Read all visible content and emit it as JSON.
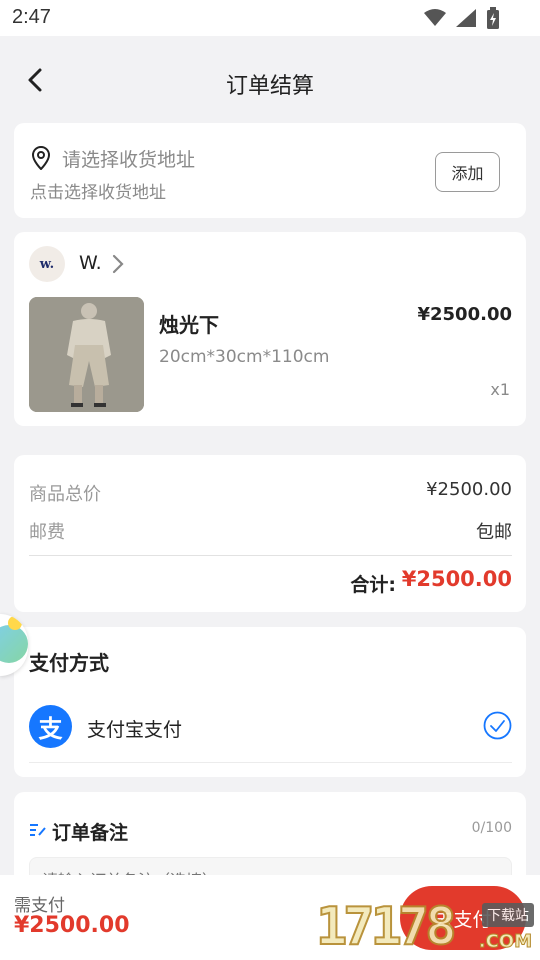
{
  "status_bar": {
    "time": "2:47"
  },
  "nav": {
    "title": "订单结算"
  },
  "address": {
    "title": "请选择收货地址",
    "subtitle": "点击选择收货地址",
    "add_label": "添加"
  },
  "shop": {
    "avatar_text": "w.",
    "name": "W.",
    "product": {
      "name": "烛光下",
      "spec": "20cm*30cm*110cm",
      "price": "¥2500.00",
      "qty": "x1"
    }
  },
  "summary": {
    "goods_label": "商品总价",
    "goods_value": "¥2500.00",
    "shipping_label": "邮费",
    "shipping_value": "包邮",
    "total_label": "合计:",
    "total_value": "¥2500.00"
  },
  "payment": {
    "title": "支付方式",
    "method_name": "支付宝支付",
    "method_icon_text": "支",
    "selected": true
  },
  "note": {
    "title": "订单备注",
    "count": "0/100",
    "placeholder": "请输入订单备注（选填）"
  },
  "footer": {
    "need_label": "需支付",
    "need_value": "¥2500.00",
    "pay_label": "去支付"
  },
  "watermark": {
    "digits": "17178",
    "tag": "下载站",
    "suffix": ".COM"
  },
  "colors": {
    "accent_red": "#e23a2c",
    "alipay_blue": "#1677ff",
    "background": "#f2f2f4"
  }
}
